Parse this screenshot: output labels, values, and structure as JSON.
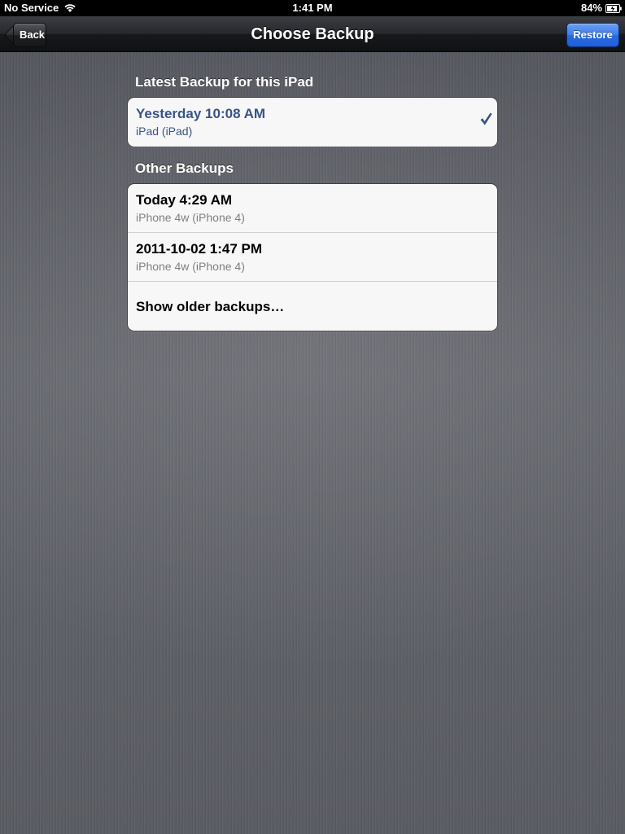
{
  "status_bar": {
    "carrier": "No Service",
    "time": "1:41 PM",
    "battery": "84%",
    "icons": [
      "wifi-icon",
      "battery-icon"
    ]
  },
  "nav_bar": {
    "title": "Choose Backup",
    "back_label": "Back",
    "restore_label": "Restore"
  },
  "latest_section": {
    "header": "Latest Backup for this iPad",
    "items": [
      {
        "title": "Yesterday 10:08 AM",
        "subtitle": "iPad (iPad)",
        "selected": true
      }
    ]
  },
  "other_section": {
    "header": "Other Backups",
    "items": [
      {
        "title": "Today 4:29 AM",
        "subtitle": "iPhone 4w (iPhone 4)"
      },
      {
        "title": "2011-10-02 1:47 PM",
        "subtitle": "iPhone 4w (iPhone 4)"
      }
    ],
    "show_older_label": "Show older backups…"
  },
  "colors": {
    "selected_text": "#385487",
    "restore_button": "#3e7de9",
    "background": "#5f6168"
  }
}
